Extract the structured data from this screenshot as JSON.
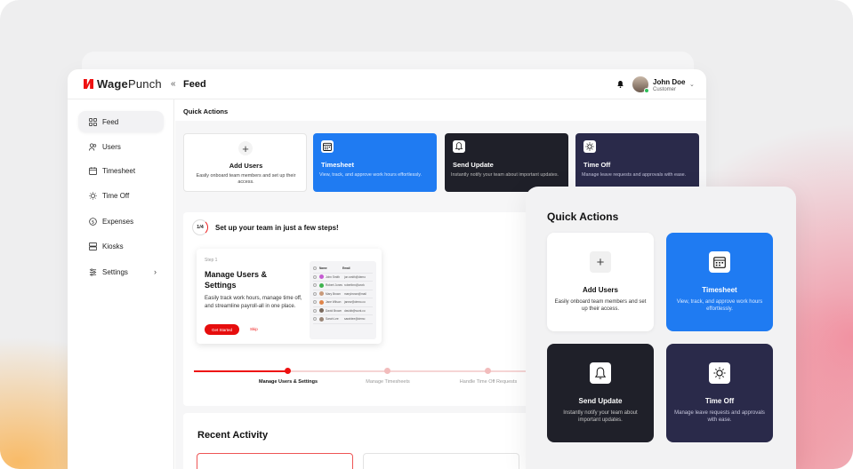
{
  "brand": {
    "name_bold": "Wage",
    "name_rest": "Punch"
  },
  "header": {
    "title": "Feed",
    "user_name": "John Doe",
    "user_role": "Customer"
  },
  "sidebar": {
    "items": [
      {
        "label": "Feed",
        "icon": "grid-icon"
      },
      {
        "label": "Users",
        "icon": "users-icon"
      },
      {
        "label": "Timesheet",
        "icon": "calendar-icon"
      },
      {
        "label": "Time Off",
        "icon": "sun-icon"
      },
      {
        "label": "Expenses",
        "icon": "dollar-icon"
      },
      {
        "label": "Kiosks",
        "icon": "kiosk-icon"
      },
      {
        "label": "Settings",
        "icon": "gear-icon"
      }
    ]
  },
  "quick_actions": {
    "title": "Quick Actions",
    "cards": [
      {
        "title": "Add Users",
        "desc": "Easily onboard team members and set up their access."
      },
      {
        "title": "Timesheet",
        "desc": "View, track, and approve work hours effortlessly."
      },
      {
        "title": "Send Update",
        "desc": "Instantly notify your team about important updates."
      },
      {
        "title": "Time Off",
        "desc": "Manage leave requests and approvals with ease."
      }
    ]
  },
  "setup": {
    "progress": "1/4",
    "title": "Set up your team in just a few steps!",
    "step_label": "Step 1",
    "step_title": "Manage Users & Settings",
    "step_desc": "Easily track work hours, manage time off, and streamline payroll-all in one place.",
    "start_label": "Get Started",
    "skip_label": "Skip",
    "mini_table": {
      "headers": [
        "Name",
        "Email"
      ],
      "rows": [
        {
          "name": "John Smith",
          "email": "jon.smith@demo"
        },
        {
          "name": "Robert Jones",
          "email": "robertbrn@work"
        },
        {
          "name": "Mary Brown",
          "email": "marybrown@mail"
        },
        {
          "name": "Jane Wilson",
          "email": "janew@demo.co"
        },
        {
          "name": "David Brown",
          "email": "davidb@work.co"
        },
        {
          "name": "Sarah Lee",
          "email": "sarahlee@demo"
        }
      ]
    },
    "progress_steps": [
      {
        "label": "Manage Users & Settings",
        "active": true
      },
      {
        "label": "Manage Timesheets",
        "active": false
      },
      {
        "label": "Handle Time Off Requests",
        "active": false
      }
    ]
  },
  "recent": {
    "title": "Recent Activity"
  },
  "overlay": {
    "title": "Quick Actions",
    "cards": [
      {
        "title": "Add Users",
        "desc": "Easily onboard team members and set up their access."
      },
      {
        "title": "Timesheet",
        "desc": "View, track, and approve work hours effortlessly."
      },
      {
        "title": "Send Update",
        "desc": "Instantly notify your team about important updates."
      },
      {
        "title": "Time Off",
        "desc": "Manage leave requests and approvals with ease."
      }
    ]
  },
  "colors": {
    "brand_red": "#e60d0d",
    "accent_blue": "#1f7bf2",
    "dark": "#1f2029",
    "navy": "#2a2a4a"
  }
}
